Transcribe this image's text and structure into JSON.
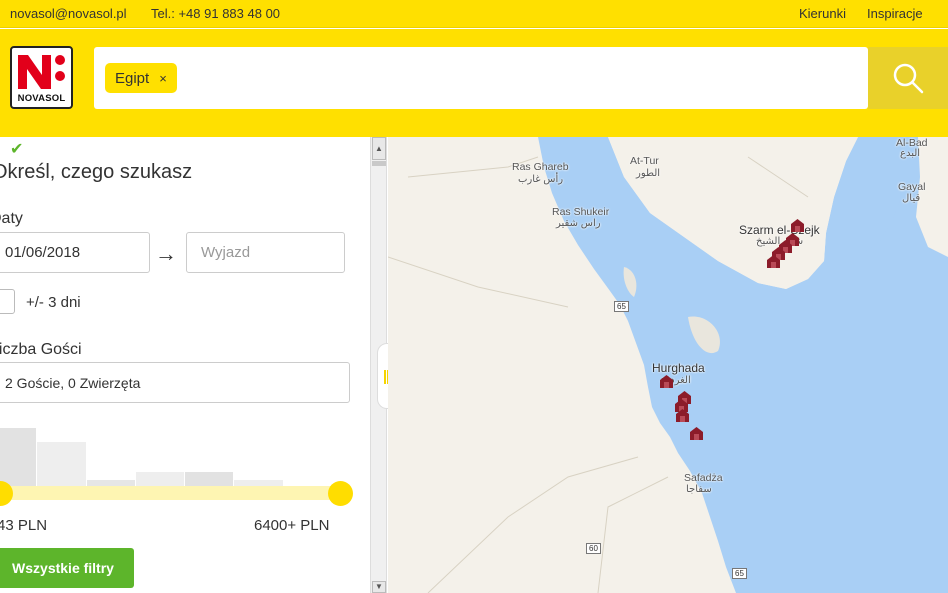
{
  "topbar": {
    "email": "novasol@novasol.pl",
    "phone": "Tel.: +48 91 883 48 00",
    "links": [
      "Kierunki",
      "Inspiracje"
    ]
  },
  "header": {
    "logo_text": "NOVASOL",
    "search_chip": "Egipt",
    "chip_remove": "×",
    "search_icon": "magnifier-icon"
  },
  "panel": {
    "title": "Określ, czego szukasz",
    "dates_label": "Daty",
    "date_from": "01/06/2018",
    "date_to_placeholder": "Wyjazd",
    "arrow": "→",
    "flex_checked": true,
    "flex_label": "+/- 3 dni",
    "guests_label": "Liczba Gości",
    "guests_value": "2 Goście, 0 Zwierzęta",
    "price_min": "43 PLN",
    "price_max": "6400+ PLN",
    "price_histogram": [
      0.85,
      0.65,
      0.1,
      0.22,
      0.22,
      0.1,
      0.0
    ],
    "filters_button": "Wszystkie filtry"
  },
  "map": {
    "labels": [
      {
        "key": "ras_ghareb",
        "text": "Ras Ghareb"
      },
      {
        "key": "ras_ghareb_ar",
        "text": "رأس غارب"
      },
      {
        "key": "at_tur",
        "text": "At-Tur"
      },
      {
        "key": "at_tur_ar",
        "text": "الطور"
      },
      {
        "key": "ras_shukeir",
        "text": "Ras Shukeir"
      },
      {
        "key": "ras_shukeir_ar",
        "text": "راس شقير"
      },
      {
        "key": "al_bad",
        "text": "Al-Bad"
      },
      {
        "key": "al_bad_ar",
        "text": "البدع"
      },
      {
        "key": "gayal",
        "text": "Gayal"
      },
      {
        "key": "gayal_ar",
        "text": "قيال"
      },
      {
        "key": "sharm",
        "text": "Szarm el-Szejk"
      },
      {
        "key": "sharm_ar",
        "text": "شرم الشيخ"
      },
      {
        "key": "hurghada",
        "text": "Hurghada"
      },
      {
        "key": "hurghada_ar",
        "text": "الغردقة"
      },
      {
        "key": "safaga",
        "text": "Safadża"
      },
      {
        "key": "safaga_ar",
        "text": "سفاجا"
      }
    ],
    "road_shields": [
      "65",
      "60",
      "65"
    ],
    "marker_count": 10
  },
  "colors": {
    "brand_yellow": "#ffe000",
    "search_button": "#e9d12a",
    "accent_green": "#5db52b",
    "sea": "#a9cff5",
    "land": "#f4f1ea",
    "marker": "#8c1c2a"
  }
}
